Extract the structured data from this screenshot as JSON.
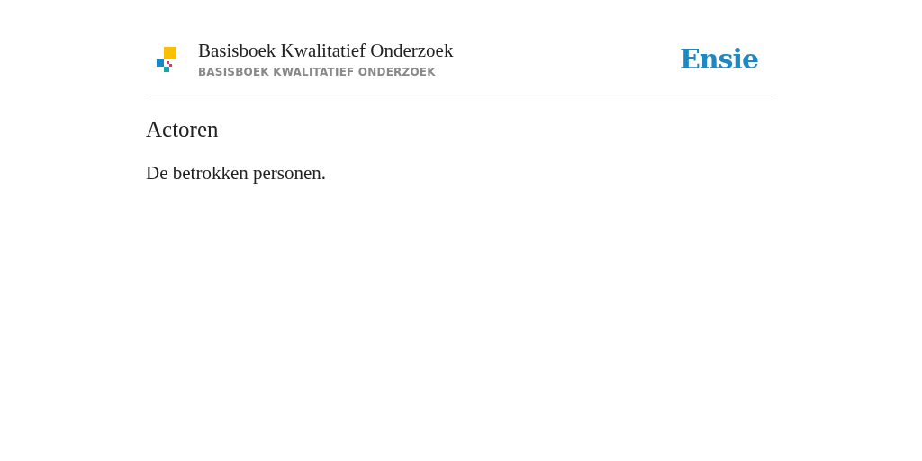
{
  "header": {
    "title": "Basisboek Kwalitatief Onderzoek",
    "subtitle": "BASISBOEK KWALITATIEF ONDERZOEK",
    "brand": "Ensie"
  },
  "entry": {
    "heading": "Actoren",
    "text": "De betrokken personen."
  }
}
